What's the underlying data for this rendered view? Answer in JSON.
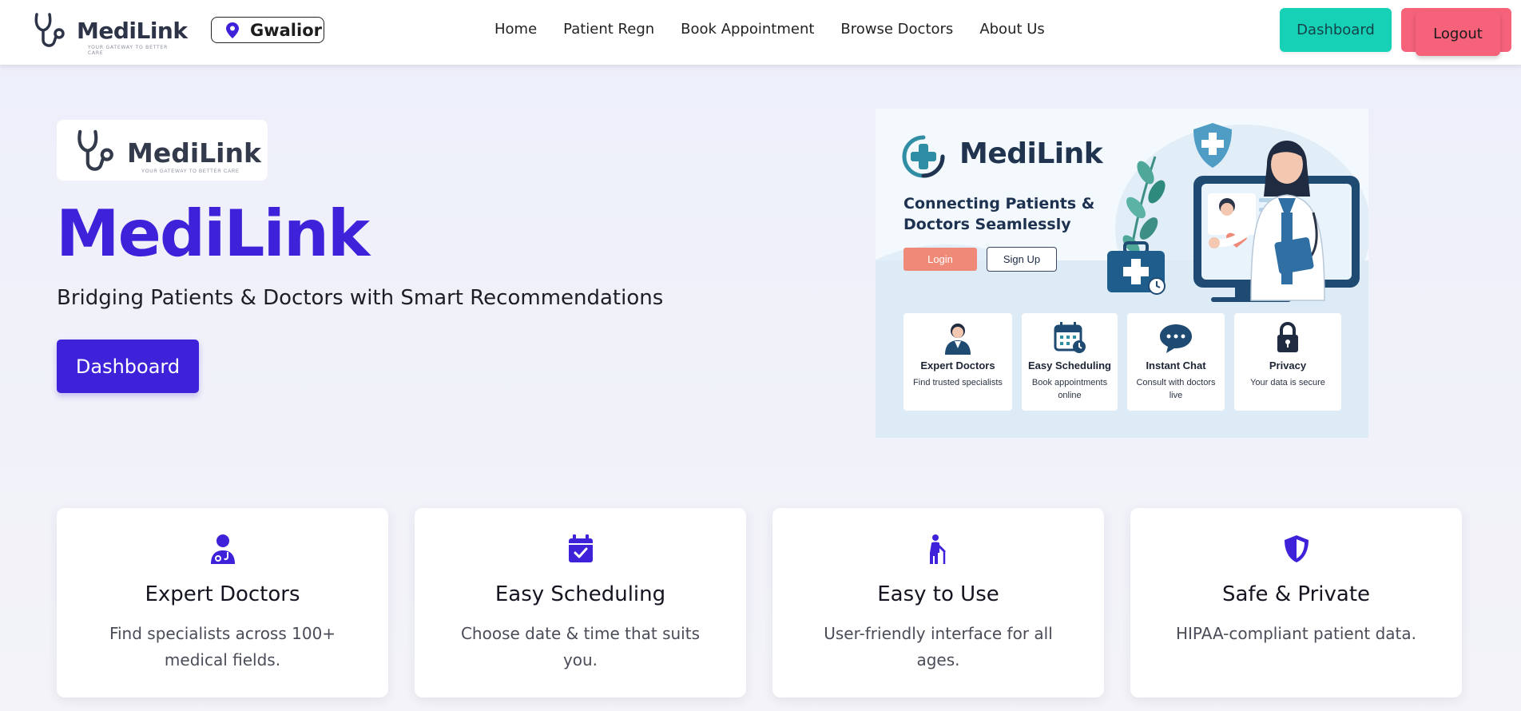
{
  "nav": {
    "logo_text": "MediLink",
    "logo_tagline": "YOUR GATEWAY TO BETTER CARE",
    "location": "Gwalior",
    "links": [
      "Home",
      "Patient Regn",
      "Book Appointment",
      "Browse Doctors",
      "About Us"
    ],
    "dashboard_label": "Dashboard",
    "logout_label": "Logout"
  },
  "hero": {
    "logo_text": "MediLink",
    "logo_tagline": "YOUR GATEWAY TO BETTER CARE",
    "title": "MediLink",
    "subtitle": "Bridging Patients & Doctors with Smart Recommendations",
    "dashboard_label": "Dashboard"
  },
  "banner": {
    "logo_text": "MediLink",
    "tagline": "Connecting Patients & Doctors Seamlessly",
    "login_label": "Login",
    "signup_label": "Sign Up",
    "cards": [
      {
        "icon": "doctor-icon",
        "title": "Expert Doctors",
        "desc": "Find trusted specialists"
      },
      {
        "icon": "calendar-icon",
        "title": "Easy Scheduling",
        "desc": "Book appointments online"
      },
      {
        "icon": "chat-icon",
        "title": "Instant Chat",
        "desc": "Consult with doctors live"
      },
      {
        "icon": "lock-icon",
        "title": "Privacy",
        "desc": "Your data is secure"
      }
    ]
  },
  "features": [
    {
      "icon": "user-doctor-icon",
      "title": "Expert Doctors",
      "desc": "Find specialists across 100+ medical fields."
    },
    {
      "icon": "calendar-check-icon",
      "title": "Easy Scheduling",
      "desc": "Choose date & time that suits you."
    },
    {
      "icon": "person-cane-icon",
      "title": "Easy to Use",
      "desc": "User-friendly interface for all ages."
    },
    {
      "icon": "shield-icon",
      "title": "Safe & Private",
      "desc": "HIPAA-compliant patient data."
    }
  ],
  "colors": {
    "primary": "#3d22d9",
    "dashboard_nav": "#16d1b5",
    "logout": "#f5627a",
    "banner_login": "#f08a78"
  }
}
